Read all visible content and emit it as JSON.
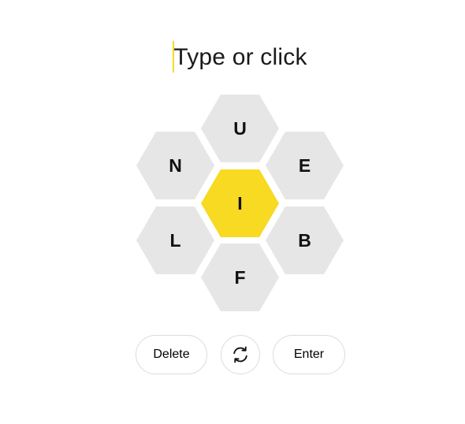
{
  "input": {
    "placeholder": "Type or click"
  },
  "hive": {
    "center_letter": "I",
    "outer_letters": {
      "top": "U",
      "upper_left": "N",
      "upper_right": "E",
      "lower_left": "L",
      "lower_right": "B",
      "bottom": "F"
    }
  },
  "controls": {
    "delete_label": "Delete",
    "shuffle_icon": "shuffle-icon",
    "enter_label": "Enter"
  },
  "colors": {
    "center_cell": "#f7da21",
    "outer_cell": "#e6e6e6",
    "caret": "#f7da21"
  }
}
